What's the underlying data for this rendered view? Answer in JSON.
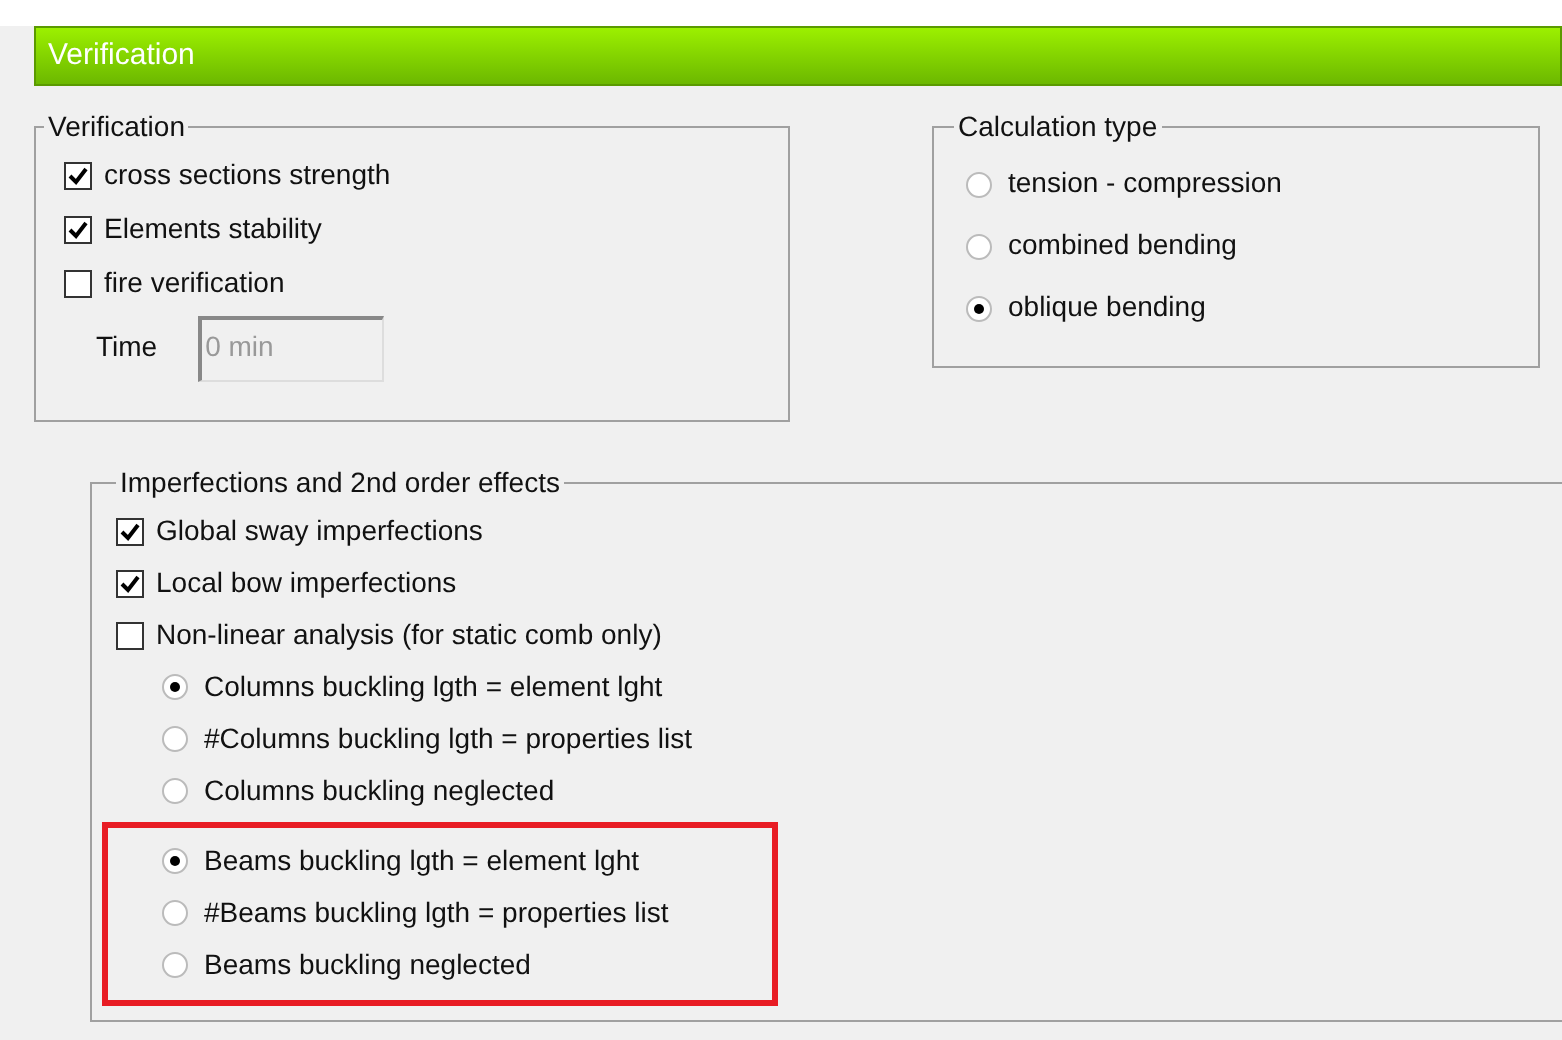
{
  "title": "Verification",
  "verification": {
    "title": "Verification",
    "checkboxes": [
      {
        "label": "cross sections strength",
        "checked": true
      },
      {
        "label": "Elements stability",
        "checked": true
      },
      {
        "label": "fire verification",
        "checked": false
      }
    ],
    "time": {
      "label": "Time",
      "value": "0 min",
      "disabled": true
    }
  },
  "calculation_type": {
    "title": "Calculation type",
    "options": [
      {
        "label": "tension - compression",
        "selected": false
      },
      {
        "label": "combined bending",
        "selected": false
      },
      {
        "label": "oblique bending",
        "selected": true
      }
    ]
  },
  "imperfections": {
    "title": "Imperfections and 2nd order effects",
    "checkboxes": [
      {
        "label": "Global sway imperfections",
        "checked": true
      },
      {
        "label": "Local bow imperfections",
        "checked": true
      },
      {
        "label": "Non-linear analysis (for static comb only)",
        "checked": false
      }
    ],
    "radio_groups": [
      {
        "highlighted": false,
        "options": [
          {
            "label": "Columns buckling lgth = element lght",
            "selected": true
          },
          {
            "label": "#Columns buckling lgth = properties list",
            "selected": false
          },
          {
            "label": "Columns buckling neglected",
            "selected": false
          }
        ]
      },
      {
        "highlighted": true,
        "options": [
          {
            "label": "Beams buckling lgth = element lght",
            "selected": true
          },
          {
            "label": "#Beams buckling lgth = properties list",
            "selected": false
          },
          {
            "label": "Beams buckling neglected",
            "selected": false
          }
        ]
      }
    ]
  }
}
